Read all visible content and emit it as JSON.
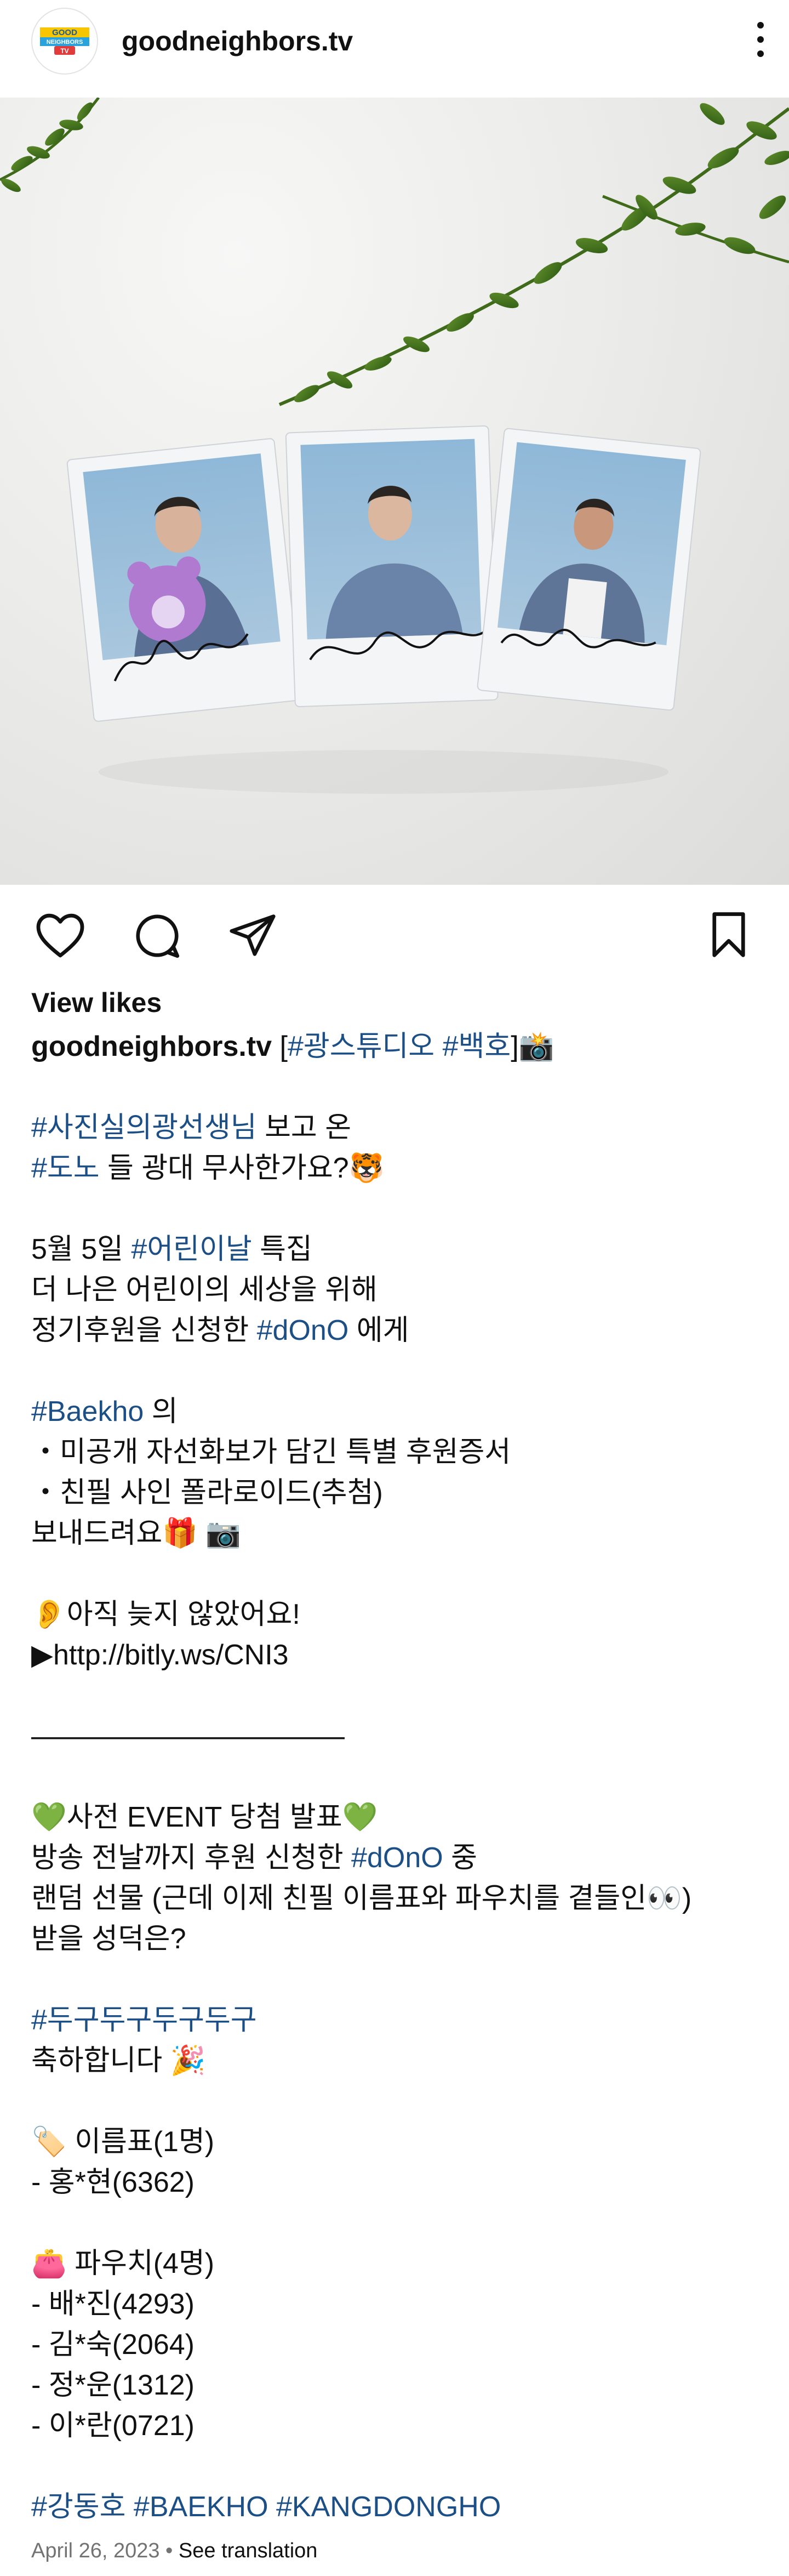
{
  "header": {
    "username": "goodneighbors.tv",
    "logo_text": "GOOD NEIGHBORS TV"
  },
  "actions": {
    "view_likes": "View likes"
  },
  "caption": {
    "username": "goodneighbors.tv",
    "title_open": "[",
    "title_tag1": "#광스튜디오",
    "title_space": " ",
    "title_tag2": "#백호",
    "title_close": "]📸",
    "p1_tag": "#사진실의광선생님",
    "p1_text": " 보고 온",
    "p2_tag": "#도노",
    "p2_text": " 들 광대 무사한가요?🐯",
    "p3_text": "5월 5일 ",
    "p3_tag": "#어린이날",
    "p3_text2": " 특집",
    "p4": "더 나은 어린이의 세상을 위해",
    "p5_text": "정기후원을 신청한 ",
    "p5_tag": "#dOnO",
    "p5_text2": " 에게",
    "p6_tag": "#Baekho",
    "p6_text": " 의",
    "p7": "・미공개 자선화보가 담긴 특별 후원증서",
    "p8": "・친필 사인 폴라로이드(추첨)",
    "p9": "보내드려요🎁 📷",
    "p10": "👂아직 늦지 않았어요!",
    "p11": "▶http://bitly.ws/CNI3",
    "divider": "———————————",
    "p12": "💚사전 EVENT 당첨 발표💚",
    "p13_text": "방송 전날까지 후원 신청한 ",
    "p13_tag": "#dOnO",
    "p13_text2": " 중",
    "p14": "랜덤 선물 (근데 이제 친필 이름표와 파우치를 곁들인👀)",
    "p15": "받을 성덕은?",
    "p16_tag": "#두구두구두구두구",
    "p17": "축하합니다 🎉",
    "p18": "🏷️ 이름표(1명)",
    "p19": "- 홍*현(6362)",
    "p20": "👛 파우치(4명)",
    "p21": "- 배*진(4293)",
    "p22": "- 김*숙(2064)",
    "p23": "- 정*운(1312)",
    "p24": "- 이*란(0721)",
    "p25_tag1": "#강동호",
    "p25_tag2": "#BAEKHO",
    "p25_tag3": "#KANGDONGHO"
  },
  "meta": {
    "date": "April 26, 2023",
    "separator": " • ",
    "translate": "See translation"
  }
}
